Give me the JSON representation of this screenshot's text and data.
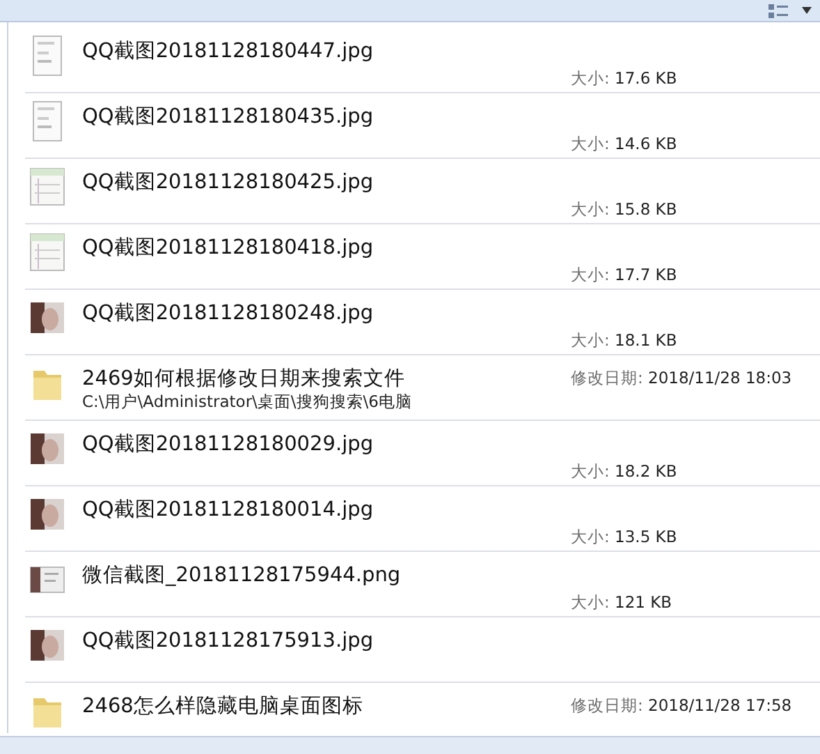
{
  "items": [
    {
      "kind": "doc",
      "name": "QQ截图20181128180447.jpg",
      "detail_label": "大小:",
      "detail_value": "17.6 KB"
    },
    {
      "kind": "doc",
      "name": "QQ截图20181128180435.jpg",
      "detail_label": "大小:",
      "detail_value": "14.6 KB"
    },
    {
      "kind": "sheet",
      "name": "QQ截图20181128180425.jpg",
      "detail_label": "大小:",
      "detail_value": "15.8 KB"
    },
    {
      "kind": "sheet",
      "name": "QQ截图20181128180418.jpg",
      "detail_label": "大小:",
      "detail_value": "17.7 KB"
    },
    {
      "kind": "photo",
      "name": "QQ截图20181128180248.jpg",
      "detail_label": "大小:",
      "detail_value": "18.1 KB"
    },
    {
      "kind": "folder",
      "name": "2469如何根据修改日期来搜索文件",
      "path": "C:\\用户\\Administrator\\桌面\\搜狗搜索\\6电脑",
      "detail_label": "修改日期:",
      "detail_value": "2018/11/28 18:03"
    },
    {
      "kind": "photo",
      "name": "QQ截图20181128180029.jpg",
      "detail_label": "大小:",
      "detail_value": "18.2 KB"
    },
    {
      "kind": "photo",
      "name": "QQ截图20181128180014.jpg",
      "detail_label": "大小:",
      "detail_value": "13.5 KB"
    },
    {
      "kind": "chat",
      "name": "微信截图_20181128175944.png",
      "detail_label": "大小:",
      "detail_value": "121 KB"
    },
    {
      "kind": "photo",
      "name": "QQ截图20181128175913.jpg"
    },
    {
      "kind": "folder",
      "name": "2468怎么样隐藏电脑桌面图标",
      "detail_label": "修改日期:",
      "detail_value": "2018/11/28 17:58"
    }
  ]
}
